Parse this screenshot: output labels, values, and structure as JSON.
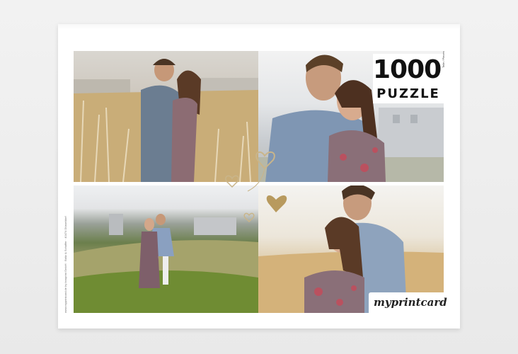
{
  "product": {
    "count": "1000",
    "count_sub": "Teile / Pieces",
    "word": "PUZZLE",
    "brand": "myprintcard",
    "side_imprint": "www.myprintcard.de by bonprint GmbH · Baltz & Schaffer · 40474 Düsseldorf"
  },
  "colors": {
    "accent_gold": "#b89a5e",
    "text_dark": "#111111"
  },
  "photos": [
    {
      "name": "couple-embrace-field"
    },
    {
      "name": "couple-closeup"
    },
    {
      "name": "couple-hill-wide"
    },
    {
      "name": "couple-kiss-forehead"
    }
  ]
}
